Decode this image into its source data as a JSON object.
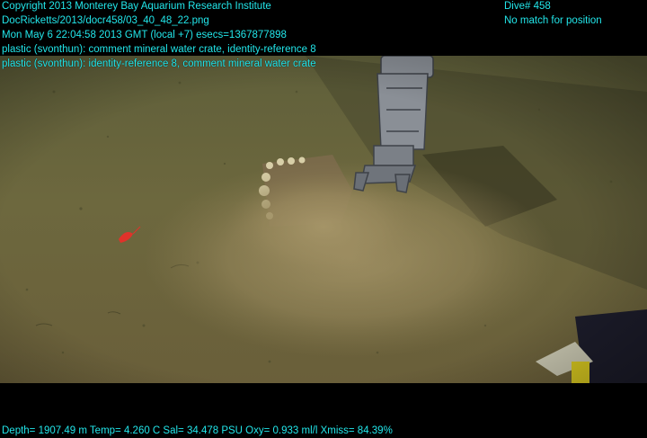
{
  "overlay": {
    "copyright": "Copyright 2013 Monterey Bay Aquarium Research Institute",
    "filename": "DocRicketts/2013/docr458/03_40_48_22.png",
    "timestamp": "Mon May  6 22:04:58 2013 GMT (local +7)  esecs=1367877898",
    "annotation_1": "plastic (svonthun): comment mineral water crate, identity-reference 8",
    "annotation_2": "plastic (svonthun): identity-reference 8, comment mineral water crate",
    "dive": "Dive# 458",
    "position_status": "No match for position",
    "sensors": "Depth= 1907.49 m  Temp= 4.260 C  Sal= 34.478 PSU  Oxy= 0.933 ml/l  Xmiss= 84.39%"
  },
  "colors": {
    "overlay_text": "#22e6ea",
    "seafloor": "#6e6a3c",
    "sediment_cloud": "#9a8a5e",
    "arm": "#8a8f96"
  },
  "scene": {
    "description_icons": [
      "seafloor-image",
      "robotic-arm-icon",
      "crate-icon",
      "sediment-cloud",
      "shrimp-icon",
      "equipment-icon"
    ]
  }
}
